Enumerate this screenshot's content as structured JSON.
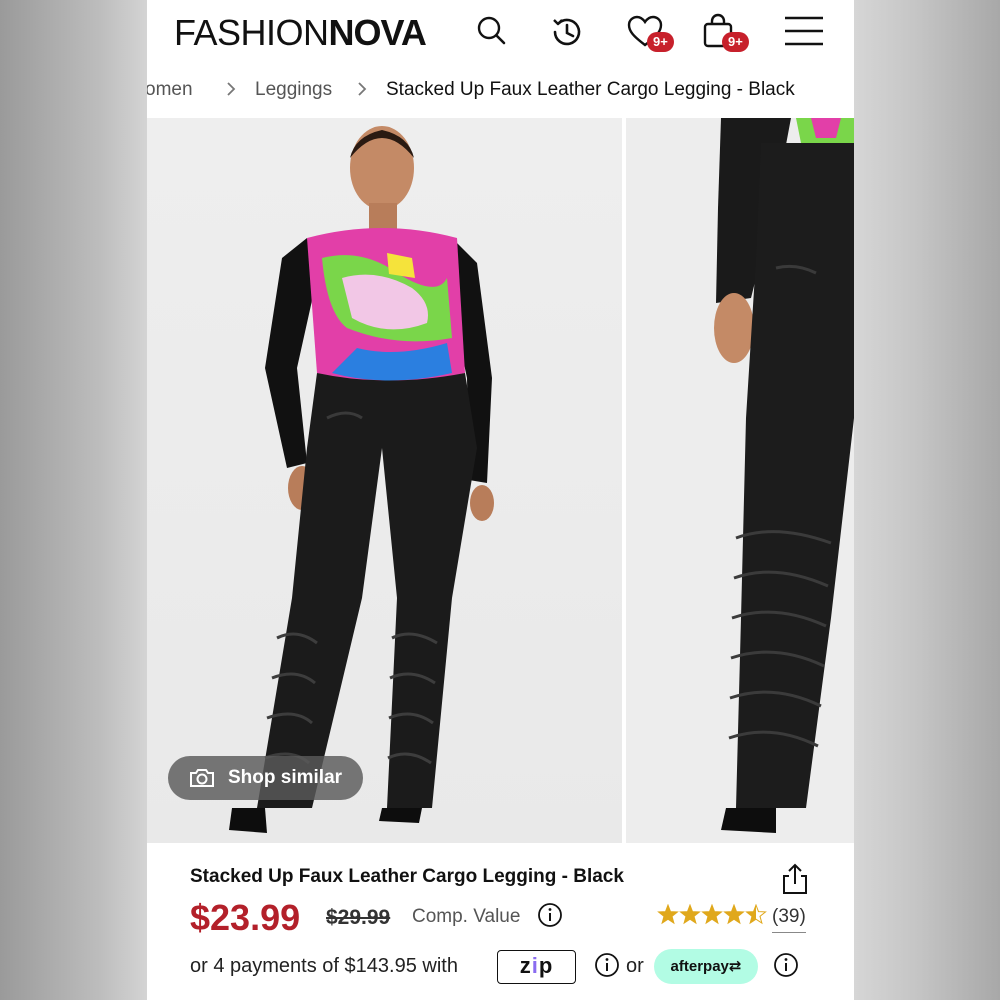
{
  "header": {
    "logo_thin": "FASHION",
    "logo_bold": "NOVA",
    "wishlist_badge": "9+",
    "cart_badge": "9+",
    "icons": [
      "search-icon",
      "history-icon",
      "heart-icon",
      "bag-icon",
      "menu-icon"
    ]
  },
  "breadcrumb": {
    "items": [
      "Women",
      "Leggings",
      "Stacked Up Faux Leather Cargo Legging - Black"
    ],
    "visible_first": "omen",
    "separator": ">"
  },
  "gallery": {
    "shop_similar_label": "Shop similar"
  },
  "product": {
    "title": "Stacked Up Faux Leather Cargo Legging - Black",
    "price": "$23.99",
    "comp_price": "$29.99",
    "comp_label": "Comp. Value",
    "rating": 4.5,
    "review_count": "(39)",
    "installments_text": "or 4 payments of $143.95 with",
    "zip_label_a": "z",
    "zip_label_b": "i",
    "zip_label_c": "p",
    "or_label": "or",
    "afterpay_label": "afterpay⇄"
  },
  "colors": {
    "price_red": "#b3202a",
    "badge_red": "#c7202b",
    "star_gold": "#e0a81c",
    "afterpay_mint": "#b2fce4",
    "zip_purple": "#8a6cf0"
  }
}
